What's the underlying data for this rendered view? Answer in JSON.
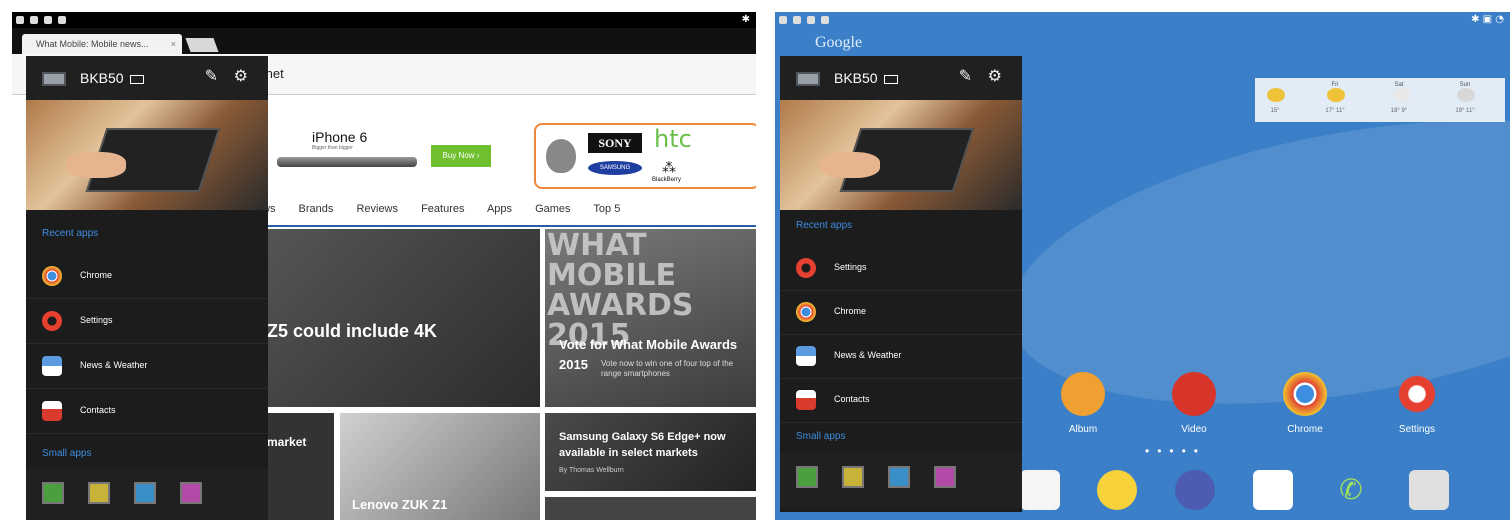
{
  "left": {
    "browser": {
      "tab_title": "What Mobile: Mobile news...",
      "tab_close": "×",
      "url": ".net"
    },
    "ads": {
      "iphone_title": "iPhone 6",
      "iphone_sub": "Bigger than bigger",
      "buy_now": "Buy Now ›",
      "brands": [
        "SONY",
        "htc",
        "SAMSUNG",
        "BlackBerry"
      ]
    },
    "nav": [
      "ws",
      "Brands",
      "Reviews",
      "Features",
      "Apps",
      "Games",
      "Top 5"
    ],
    "tiles": {
      "t1": "Z5 could include 4K",
      "t2_banner": "WHAT MOBILE AWARDS 2015",
      "t2_title": "Vote for What Mobile Awards 2015",
      "t2_sub": "Vote now to win one of four top of the range smartphones",
      "t3": "market",
      "t4": "Lenovo ZUK Z1",
      "t5_title": "Samsung Galaxy S6 Edge+ now available in select markets",
      "t5_by": "By Thomas Wellburn"
    },
    "drawer": {
      "device": "BKB50",
      "recent_label": "Recent apps",
      "recent": [
        "Chrome",
        "Settings",
        "News & Weather",
        "Contacts"
      ],
      "small_label": "Small apps"
    }
  },
  "right": {
    "google": "Google",
    "weather": {
      "days": [
        "",
        "Fri",
        "Sat",
        "Sun"
      ],
      "temps": [
        "15°",
        "17° 11°",
        "18° 9°",
        "19° 11°"
      ]
    },
    "drawer": {
      "device": "BKB50",
      "recent_label": "Recent apps",
      "recent": [
        "Settings",
        "Chrome",
        "News & Weather",
        "Contacts"
      ],
      "small_label": "Small apps"
    },
    "home_apps": [
      "Album",
      "Video",
      "Chrome",
      "Settings"
    ]
  },
  "colors": {
    "accent": "#3d8de0",
    "drawer_bg": "#1c1c1c",
    "home_bg": "#3a7fc8",
    "brand_border": "#f0873a",
    "buy_now": "#6fbf2e"
  },
  "icons": {
    "edit": "pencil-icon",
    "settings": "gear-icon",
    "chrome": "chrome-icon",
    "settings_app": "settings-gear-icon",
    "news": "news-weather-icon",
    "contacts": "contacts-icon"
  }
}
